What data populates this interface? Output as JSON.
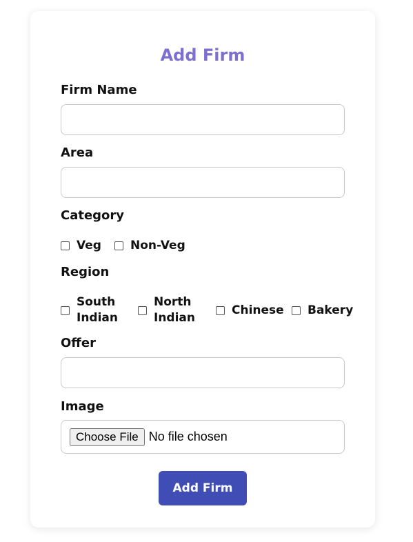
{
  "form": {
    "title": "Add Firm",
    "firm_name": {
      "label": "Firm Name",
      "value": "",
      "placeholder": ""
    },
    "area": {
      "label": "Area",
      "value": "",
      "placeholder": ""
    },
    "category": {
      "label": "Category",
      "options": [
        {
          "label": "Veg",
          "checked": false
        },
        {
          "label": "Non-Veg",
          "checked": false
        }
      ]
    },
    "region": {
      "label": "Region",
      "options": [
        {
          "label": "South Indian",
          "line1": "South",
          "line2": "Indian",
          "checked": false
        },
        {
          "label": "North Indian",
          "line1": "North",
          "line2": "Indian",
          "checked": false
        },
        {
          "label": "Chinese",
          "checked": false
        },
        {
          "label": "Bakery",
          "checked": false
        }
      ]
    },
    "offer": {
      "label": "Offer",
      "value": "",
      "placeholder": ""
    },
    "image": {
      "label": "Image",
      "button_label": "Choose File",
      "status": "No file chosen"
    },
    "submit_label": "Add Firm"
  },
  "colors": {
    "title": "#7b6fd1",
    "submit_bg": "#3f4db5",
    "submit_text": "#ffffff"
  }
}
